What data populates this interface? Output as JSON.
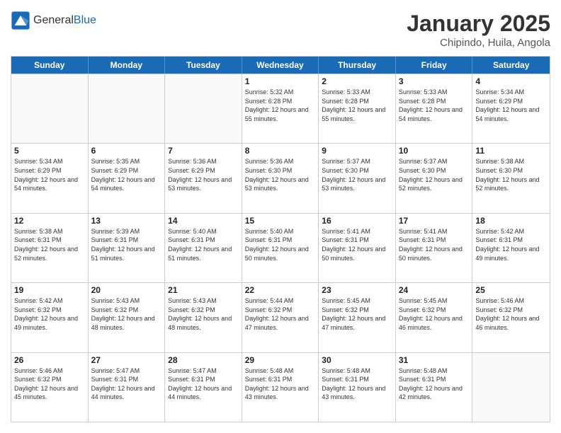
{
  "logo": {
    "general": "General",
    "blue": "Blue"
  },
  "header": {
    "month": "January 2025",
    "location": "Chipindo, Huila, Angola"
  },
  "days": [
    "Sunday",
    "Monday",
    "Tuesday",
    "Wednesday",
    "Thursday",
    "Friday",
    "Saturday"
  ],
  "weeks": [
    [
      {
        "day": "",
        "empty": true
      },
      {
        "day": "",
        "empty": true
      },
      {
        "day": "",
        "empty": true
      },
      {
        "day": "1",
        "sunrise": "5:32 AM",
        "sunset": "6:28 PM",
        "daylight": "12 hours and 55 minutes."
      },
      {
        "day": "2",
        "sunrise": "5:33 AM",
        "sunset": "6:28 PM",
        "daylight": "12 hours and 55 minutes."
      },
      {
        "day": "3",
        "sunrise": "5:33 AM",
        "sunset": "6:28 PM",
        "daylight": "12 hours and 54 minutes."
      },
      {
        "day": "4",
        "sunrise": "5:34 AM",
        "sunset": "6:29 PM",
        "daylight": "12 hours and 54 minutes."
      }
    ],
    [
      {
        "day": "5",
        "sunrise": "5:34 AM",
        "sunset": "6:29 PM",
        "daylight": "12 hours and 54 minutes."
      },
      {
        "day": "6",
        "sunrise": "5:35 AM",
        "sunset": "6:29 PM",
        "daylight": "12 hours and 54 minutes."
      },
      {
        "day": "7",
        "sunrise": "5:36 AM",
        "sunset": "6:29 PM",
        "daylight": "12 hours and 53 minutes."
      },
      {
        "day": "8",
        "sunrise": "5:36 AM",
        "sunset": "6:30 PM",
        "daylight": "12 hours and 53 minutes."
      },
      {
        "day": "9",
        "sunrise": "5:37 AM",
        "sunset": "6:30 PM",
        "daylight": "12 hours and 53 minutes."
      },
      {
        "day": "10",
        "sunrise": "5:37 AM",
        "sunset": "6:30 PM",
        "daylight": "12 hours and 52 minutes."
      },
      {
        "day": "11",
        "sunrise": "5:38 AM",
        "sunset": "6:30 PM",
        "daylight": "12 hours and 52 minutes."
      }
    ],
    [
      {
        "day": "12",
        "sunrise": "5:38 AM",
        "sunset": "6:31 PM",
        "daylight": "12 hours and 52 minutes."
      },
      {
        "day": "13",
        "sunrise": "5:39 AM",
        "sunset": "6:31 PM",
        "daylight": "12 hours and 51 minutes."
      },
      {
        "day": "14",
        "sunrise": "5:40 AM",
        "sunset": "6:31 PM",
        "daylight": "12 hours and 51 minutes."
      },
      {
        "day": "15",
        "sunrise": "5:40 AM",
        "sunset": "6:31 PM",
        "daylight": "12 hours and 50 minutes."
      },
      {
        "day": "16",
        "sunrise": "5:41 AM",
        "sunset": "6:31 PM",
        "daylight": "12 hours and 50 minutes."
      },
      {
        "day": "17",
        "sunrise": "5:41 AM",
        "sunset": "6:31 PM",
        "daylight": "12 hours and 50 minutes."
      },
      {
        "day": "18",
        "sunrise": "5:42 AM",
        "sunset": "6:31 PM",
        "daylight": "12 hours and 49 minutes."
      }
    ],
    [
      {
        "day": "19",
        "sunrise": "5:42 AM",
        "sunset": "6:32 PM",
        "daylight": "12 hours and 49 minutes."
      },
      {
        "day": "20",
        "sunrise": "5:43 AM",
        "sunset": "6:32 PM",
        "daylight": "12 hours and 48 minutes."
      },
      {
        "day": "21",
        "sunrise": "5:43 AM",
        "sunset": "6:32 PM",
        "daylight": "12 hours and 48 minutes."
      },
      {
        "day": "22",
        "sunrise": "5:44 AM",
        "sunset": "6:32 PM",
        "daylight": "12 hours and 47 minutes."
      },
      {
        "day": "23",
        "sunrise": "5:45 AM",
        "sunset": "6:32 PM",
        "daylight": "12 hours and 47 minutes."
      },
      {
        "day": "24",
        "sunrise": "5:45 AM",
        "sunset": "6:32 PM",
        "daylight": "12 hours and 46 minutes."
      },
      {
        "day": "25",
        "sunrise": "5:46 AM",
        "sunset": "6:32 PM",
        "daylight": "12 hours and 46 minutes."
      }
    ],
    [
      {
        "day": "26",
        "sunrise": "5:46 AM",
        "sunset": "6:32 PM",
        "daylight": "12 hours and 45 minutes."
      },
      {
        "day": "27",
        "sunrise": "5:47 AM",
        "sunset": "6:31 PM",
        "daylight": "12 hours and 44 minutes."
      },
      {
        "day": "28",
        "sunrise": "5:47 AM",
        "sunset": "6:31 PM",
        "daylight": "12 hours and 44 minutes."
      },
      {
        "day": "29",
        "sunrise": "5:48 AM",
        "sunset": "6:31 PM",
        "daylight": "12 hours and 43 minutes."
      },
      {
        "day": "30",
        "sunrise": "5:48 AM",
        "sunset": "6:31 PM",
        "daylight": "12 hours and 43 minutes."
      },
      {
        "day": "31",
        "sunrise": "5:48 AM",
        "sunset": "6:31 PM",
        "daylight": "12 hours and 42 minutes."
      },
      {
        "day": "",
        "empty": true
      }
    ]
  ]
}
